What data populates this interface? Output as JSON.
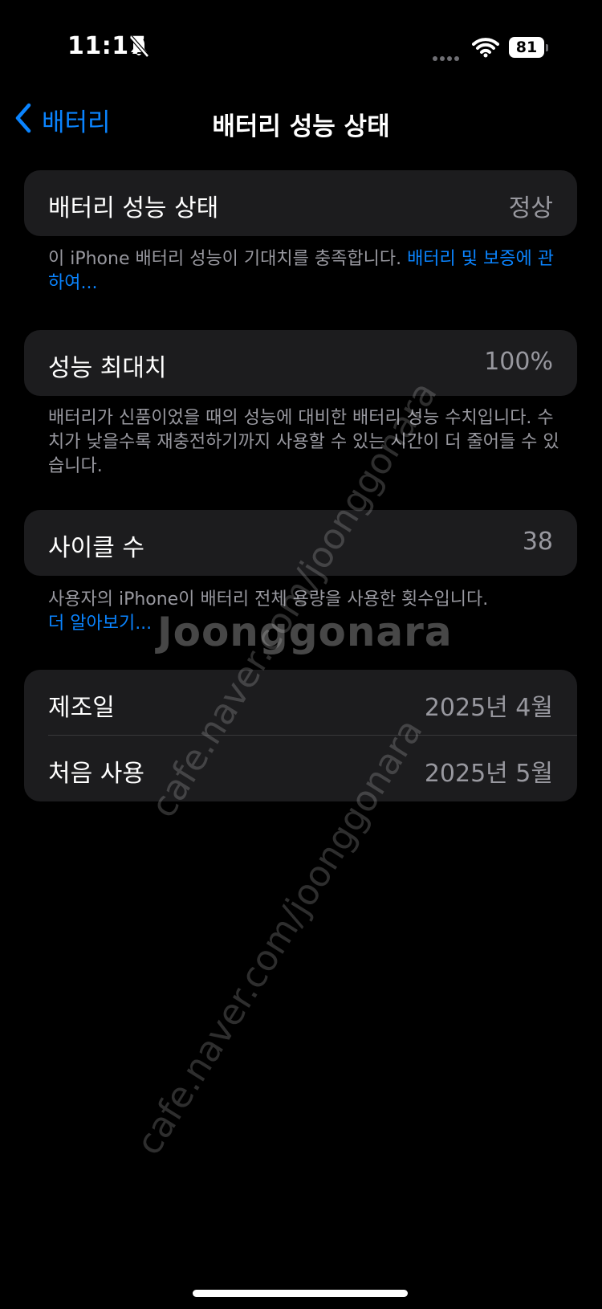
{
  "status_bar": {
    "time": "11:17",
    "battery_level": "81",
    "icons": [
      "bell-slash-icon",
      "signal-dots-icon",
      "wifi-icon",
      "battery-icon"
    ]
  },
  "nav": {
    "back_label": "배터리",
    "title": "배터리 성능 상태",
    "back_icon": "chevron-left-icon"
  },
  "health": {
    "label": "배터리 성능 상태",
    "value": "정상",
    "footnote": "이 iPhone 배터리 성능이 기대치를 충족합니다. ",
    "footnote_link": "배터리 및 보증에 관하여..."
  },
  "capacity": {
    "label": "성능 최대치",
    "value": "100%",
    "footnote": "배터리가 신품이었을 때의 성능에 대비한 배터리 성능 수치입니다. 수치가 낮을수록 재충전하기까지 사용할 수 있는 시간이 더 줄어들 수 있습니다."
  },
  "cycles": {
    "label": "사이클 수",
    "value": "38",
    "footnote": "사용자의 iPhone이 배터리 전체 용량을 사용한 횟수입니다.",
    "footnote_link": "더 알아보기..."
  },
  "dates": {
    "manufacture_label": "제조일",
    "manufacture_value": "2025년 4월",
    "first_use_label": "처음 사용",
    "first_use_value": "2025년 5월"
  },
  "watermark": {
    "text": "cafe.naver.com/joonggonara",
    "brand": "Joonggonara"
  },
  "colors": {
    "accent": "#0a84ff",
    "background": "#000000",
    "card": "#1c1c1e",
    "secondary_text": "#98989f"
  }
}
